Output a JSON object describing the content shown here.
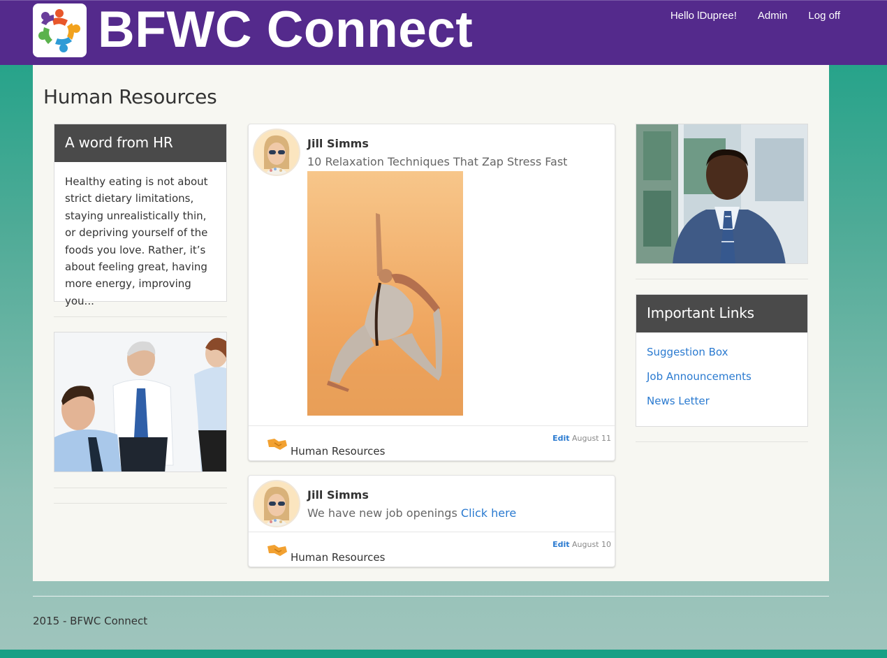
{
  "header": {
    "brand": "BFWC Connect",
    "nav": {
      "greeting": "Hello lDupree!",
      "admin": "Admin",
      "logoff": "Log off"
    }
  },
  "page": {
    "title": "Human Resources"
  },
  "hr_panel": {
    "heading": "A word from HR",
    "text": "Healthy eating is not about strict dietary limitations, staying unrealistically thin, or depriving yourself of the foods you love. Rather, it’s about feeling great, having more energy, improving you..."
  },
  "posts": [
    {
      "author": "Jill Simms",
      "text": "10 Relaxation Techniques That Zap Stress Fast",
      "link_text": "",
      "category": "Human Resources",
      "edit_label": "Edit",
      "date": "August 11"
    },
    {
      "author": "Jill Simms",
      "text": "We have new job openings",
      "link_text": "Click here",
      "category": "Human Resources",
      "edit_label": "Edit",
      "date": "August 10"
    }
  ],
  "links_panel": {
    "heading": "Important Links",
    "items": [
      "Suggestion Box",
      "Job Announcements",
      "News Letter"
    ]
  },
  "footer": {
    "text": "2015 - BFWC Connect"
  },
  "colors": {
    "navbar": "#542a8c",
    "panel_head": "#4a4a4a",
    "link": "#2a7ad0",
    "background": "#17a085"
  }
}
